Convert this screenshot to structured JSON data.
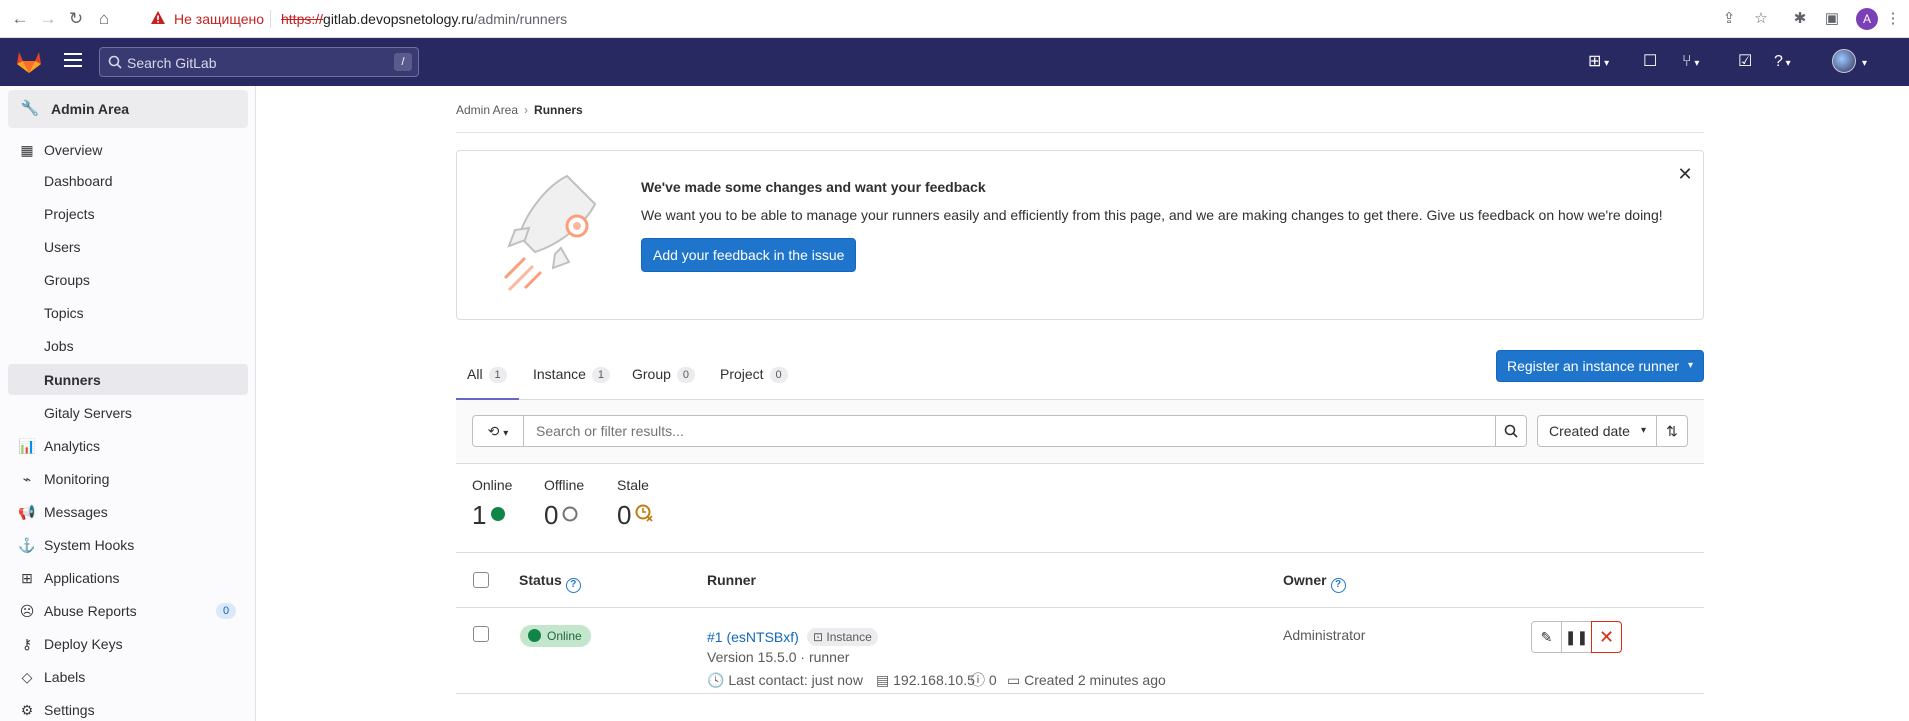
{
  "browser": {
    "security_label": "Не защищено",
    "url_scheme": "https://",
    "url_host": "gitlab.devopsnetology.ru",
    "url_path": "/admin/runners",
    "profile_initial": "A"
  },
  "topbar": {
    "search_placeholder": "Search GitLab",
    "search_shortcut": "/"
  },
  "sidebar": {
    "header": "Admin Area",
    "items": [
      {
        "label": "Overview",
        "icon": "overview-icon"
      },
      {
        "label": "Dashboard"
      },
      {
        "label": "Projects"
      },
      {
        "label": "Users"
      },
      {
        "label": "Groups"
      },
      {
        "label": "Topics"
      },
      {
        "label": "Jobs"
      },
      {
        "label": "Runners",
        "active": true
      },
      {
        "label": "Gitaly Servers"
      },
      {
        "label": "Analytics",
        "icon": "analytics-icon"
      },
      {
        "label": "Monitoring",
        "icon": "monitoring-icon"
      },
      {
        "label": "Messages",
        "icon": "messages-icon"
      },
      {
        "label": "System Hooks",
        "icon": "hooks-icon"
      },
      {
        "label": "Applications",
        "icon": "applications-icon"
      },
      {
        "label": "Abuse Reports",
        "icon": "abuse-icon",
        "count": "0"
      },
      {
        "label": "Deploy Keys",
        "icon": "key-icon"
      },
      {
        "label": "Labels",
        "icon": "label-icon"
      },
      {
        "label": "Settings",
        "icon": "settings-icon"
      }
    ]
  },
  "breadcrumb": {
    "parent": "Admin Area",
    "current": "Runners"
  },
  "banner": {
    "title": "We've made some changes and want your feedback",
    "text": "We want you to be able to manage your runners easily and efficiently from this page, and we are making changes to get there. Give us feedback on how we're doing!",
    "button": "Add your feedback in the issue"
  },
  "tabs": [
    {
      "label": "All",
      "count": "1"
    },
    {
      "label": "Instance",
      "count": "1"
    },
    {
      "label": "Group",
      "count": "0"
    },
    {
      "label": "Project",
      "count": "0"
    }
  ],
  "register_button": "Register an instance runner",
  "filter": {
    "placeholder": "Search or filter results...",
    "sort_label": "Created date"
  },
  "stats": {
    "online": {
      "label": "Online",
      "value": "1"
    },
    "offline": {
      "label": "Offline",
      "value": "0"
    },
    "stale": {
      "label": "Stale",
      "value": "0"
    }
  },
  "table": {
    "headers": {
      "status": "Status",
      "runner": "Runner",
      "owner": "Owner"
    },
    "rows": [
      {
        "status": "Online",
        "runner_id": "#1 (esNTSBxf)",
        "runner_type": "Instance",
        "version": "Version 15.5.0 · runner",
        "last_contact": "Last contact: just now",
        "ip": "192.168.10.5",
        "jobs": "0",
        "created": "Created 2 minutes ago",
        "owner": "Administrator"
      }
    ]
  },
  "colors": {
    "topbar": "#292961",
    "primary": "#1f75cb",
    "online": "#108548",
    "danger": "#dd2b0e",
    "stale": "#c17d10"
  }
}
